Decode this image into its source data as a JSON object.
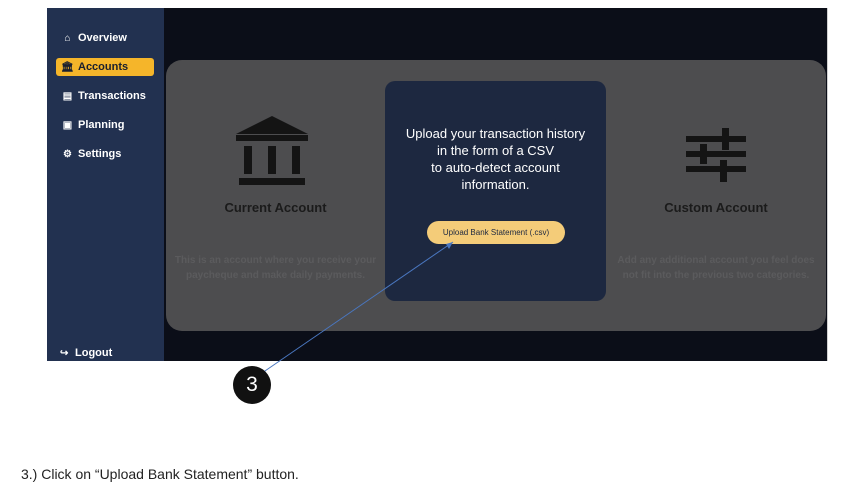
{
  "sidebar": {
    "items": [
      {
        "icon": "home-icon",
        "label": "Overview"
      },
      {
        "icon": "bank-icon",
        "label": "Accounts",
        "active": true
      },
      {
        "icon": "receipt-icon",
        "label": "Transactions"
      },
      {
        "icon": "chart-icon",
        "label": "Planning"
      },
      {
        "icon": "gear-icon",
        "label": "Settings"
      }
    ],
    "logout_label": "Logout"
  },
  "cards": {
    "current": {
      "title": "Current Account",
      "description": "This is an account where you receive your paycheque and make daily payments."
    },
    "custom": {
      "title": "Custom Account",
      "description": "Add any additional account you feel does not fit into the previous two categories."
    },
    "upload": {
      "text_lines": [
        "Upload your transaction history",
        "in the form of a CSV",
        "to auto-detect account",
        "information."
      ],
      "button_label": "Upload Bank Statement (.csv)"
    }
  },
  "annotation": {
    "step_number": "3"
  },
  "instruction": "3.)  Click on “Upload Bank Statement” button.",
  "colors": {
    "sidebar_bg": "#223150",
    "accent": "#f5b52a",
    "upload_card_bg": "#1d2840",
    "upload_button": "#f4cc79",
    "overlay_panel": "#4d4d4f"
  }
}
